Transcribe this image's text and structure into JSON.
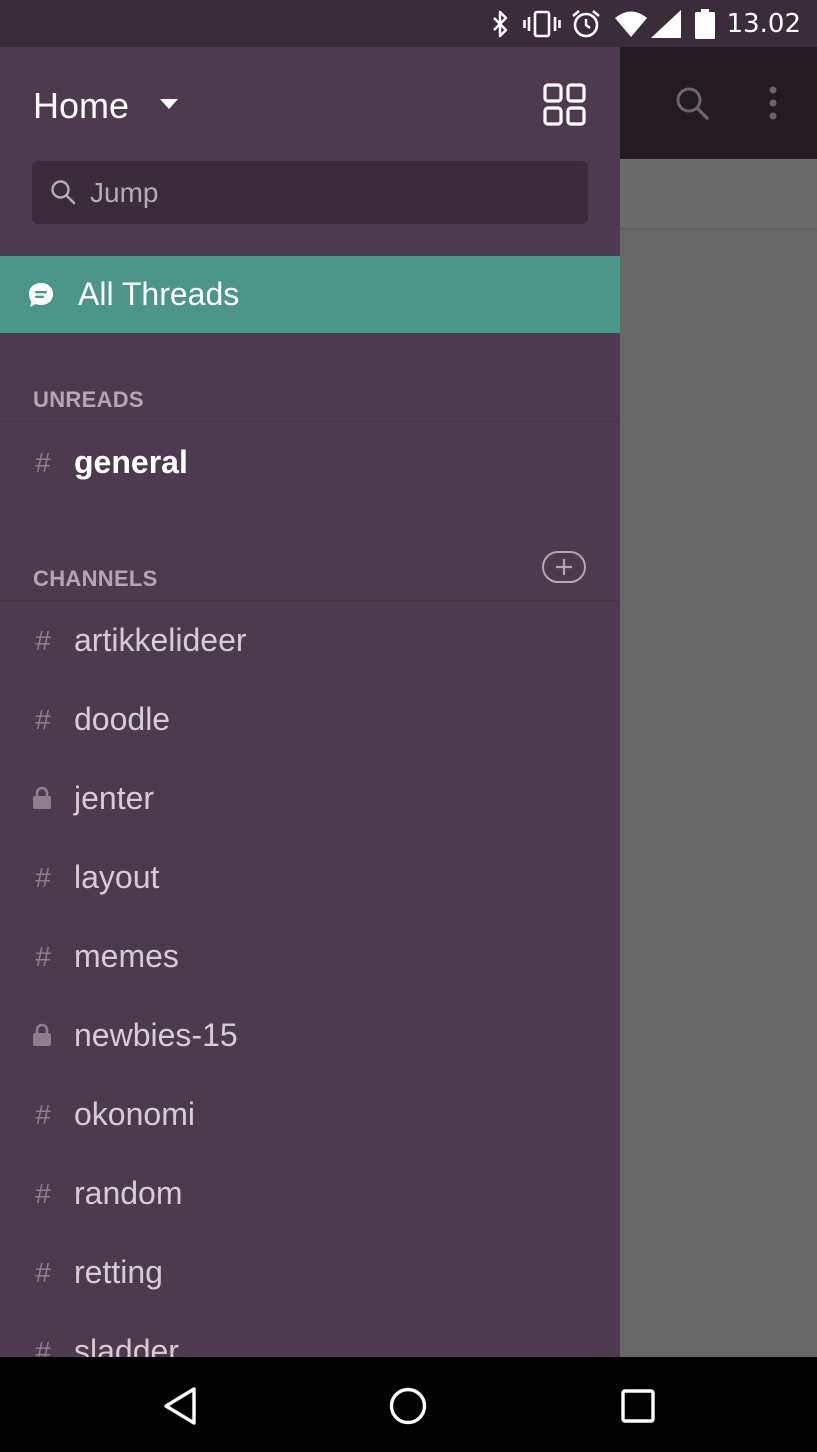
{
  "status_bar": {
    "time": "13.02",
    "icons": [
      "bluetooth-icon",
      "vibrate-icon",
      "alarm-icon",
      "wifi-icon",
      "signal-icon",
      "battery-icon"
    ]
  },
  "drawer": {
    "team_name": "Home",
    "search": {
      "placeholder": "Jump",
      "value": ""
    },
    "all_threads_label": "All Threads",
    "unreads": {
      "header": "UNREADS",
      "items": [
        {
          "name": "general",
          "type": "public",
          "unread": true
        }
      ]
    },
    "channels": {
      "header": "CHANNELS",
      "items": [
        {
          "name": "artikkelideer",
          "type": "public"
        },
        {
          "name": "doodle",
          "type": "public"
        },
        {
          "name": "jenter",
          "type": "private"
        },
        {
          "name": "layout",
          "type": "public"
        },
        {
          "name": "memes",
          "type": "public"
        },
        {
          "name": "newbies-15",
          "type": "private"
        },
        {
          "name": "okonomi",
          "type": "public"
        },
        {
          "name": "random",
          "type": "public"
        },
        {
          "name": "retting",
          "type": "public"
        },
        {
          "name": "sladder",
          "type": "public"
        }
      ]
    }
  },
  "prefix": {
    "public": "#"
  },
  "colors": {
    "drawer_bg": "#4e3a4e",
    "active_item": "#4c9689",
    "status_bar": "#3b2c3a"
  }
}
